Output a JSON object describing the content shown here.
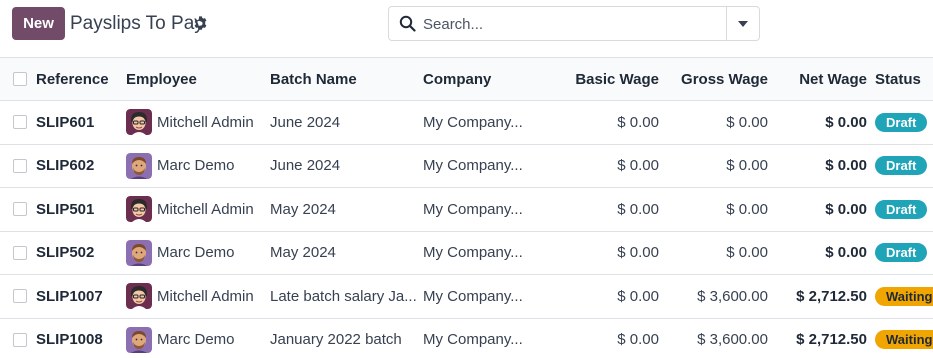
{
  "control_panel": {
    "new_label": "New",
    "title": "Payslips To Pay",
    "search_placeholder": "Search..."
  },
  "columns": {
    "reference": "Reference",
    "employee": "Employee",
    "batch": "Batch Name",
    "company": "Company",
    "basic_wage": "Basic Wage",
    "gross_wage": "Gross Wage",
    "net_wage": "Net Wage",
    "status": "Status"
  },
  "colors": {
    "brand": "#714B67",
    "draft": "#1fa4b8",
    "waiting": "#f0a500"
  },
  "rows": [
    {
      "reference": "SLIP601",
      "employee": "Mitchell Admin",
      "avatar": "mitchell",
      "batch": "June 2024",
      "company": "My Company...",
      "basic": "$ 0.00",
      "gross": "$ 0.00",
      "net": "$ 0.00",
      "status": "Draft",
      "status_kind": "draft"
    },
    {
      "reference": "SLIP602",
      "employee": "Marc Demo",
      "avatar": "marc",
      "batch": "June 2024",
      "company": "My Company...",
      "basic": "$ 0.00",
      "gross": "$ 0.00",
      "net": "$ 0.00",
      "status": "Draft",
      "status_kind": "draft"
    },
    {
      "reference": "SLIP501",
      "employee": "Mitchell Admin",
      "avatar": "mitchell",
      "batch": "May 2024",
      "company": "My Company...",
      "basic": "$ 0.00",
      "gross": "$ 0.00",
      "net": "$ 0.00",
      "status": "Draft",
      "status_kind": "draft"
    },
    {
      "reference": "SLIP502",
      "employee": "Marc Demo",
      "avatar": "marc",
      "batch": "May 2024",
      "company": "My Company...",
      "basic": "$ 0.00",
      "gross": "$ 0.00",
      "net": "$ 0.00",
      "status": "Draft",
      "status_kind": "draft"
    },
    {
      "reference": "SLIP1007",
      "employee": "Mitchell Admin",
      "avatar": "mitchell",
      "batch": "Late batch salary Ja...",
      "company": "My Company...",
      "basic": "$ 0.00",
      "gross": "$ 3,600.00",
      "net": "$ 2,712.50",
      "status": "Waiting",
      "status_kind": "waiting"
    },
    {
      "reference": "SLIP1008",
      "employee": "Marc Demo",
      "avatar": "marc",
      "batch": "January 2022 batch",
      "company": "My Company...",
      "basic": "$ 0.00",
      "gross": "$ 3,600.00",
      "net": "$ 2,712.50",
      "status": "Waiting",
      "status_kind": "waiting"
    }
  ]
}
